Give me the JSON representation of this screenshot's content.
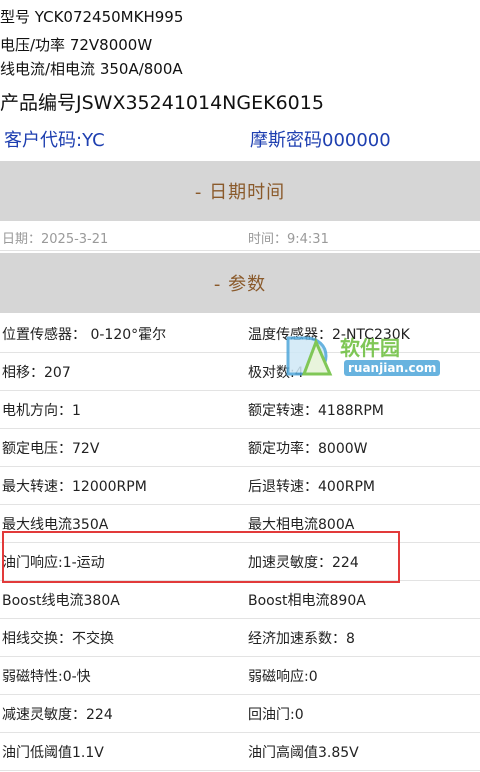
{
  "header": {
    "model_line": "型号  YCK072450MKH995",
    "voltage_line": "电压/功率  72V8000W",
    "current_line": "线电流/相电流   350A/800A",
    "product_code": "产品编号JSWX35241014NGEK6015",
    "customer_code": "客户代码:YC",
    "morse_code": "摩斯密码000000"
  },
  "date_section": {
    "title": "- 日期时间",
    "date": "日期：2025-3-21",
    "time": "时间：9:4:31"
  },
  "params_section": {
    "title": "- 参数",
    "rows": [
      {
        "left": "位置传感器：  0-120°霍尔",
        "right": "温度传感器：2-NTC230K"
      },
      {
        "left": "相移：207",
        "right": "极对数:4"
      },
      {
        "left": "电机方向：1",
        "right": "额定转速：4188RPM"
      },
      {
        "left": "额定电压：72V",
        "right": "额定功率：8000W"
      },
      {
        "left": "最大转速：12000RPM",
        "right": "后退转速：400RPM"
      },
      {
        "left": "最大线电流350A",
        "right": "最大相电流800A"
      },
      {
        "left": "油门响应:1-运动",
        "right": "加速灵敏度：224"
      },
      {
        "left": "Boost线电流380A",
        "right": "Boost相电流890A"
      },
      {
        "left": "相线交换：不交换",
        "right": "经济加速系数：8"
      },
      {
        "left": "弱磁特性:0-快",
        "right": "弱磁响应:0"
      },
      {
        "left": "减速灵敏度：224",
        "right": "回油门:0"
      },
      {
        "left": "油门低阈值1.1V",
        "right": "油门高阈值3.85V"
      }
    ]
  },
  "watermark": {
    "name": "软件园",
    "url": "ruanjian.com"
  },
  "colors": {
    "section_bg": "#d6d6d6",
    "section_title": "#8a5a2b",
    "blue_text": "#1e3fb0",
    "highlight": "#e23a3a"
  }
}
